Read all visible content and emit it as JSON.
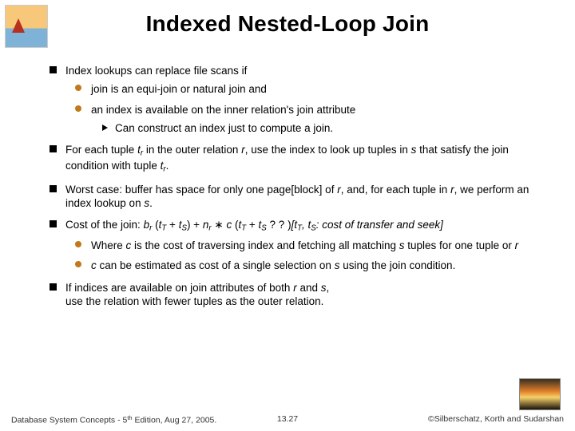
{
  "title": "Indexed Nested-Loop Join",
  "b1": {
    "text": "Index lookups can replace file scans if",
    "s1": "join is an equi-join or natural join and",
    "s2": "an index is available on the inner relation's join attribute",
    "s2a": "Can construct an index just to compute a join."
  },
  "b2": {
    "p1": "For each tuple",
    "p2": "in the outer relation",
    "p3": ", use the index to look up tuples in",
    "p4": "that satisfy the join condition with tuple"
  },
  "b3": {
    "p1": "Worst case: buffer has space for only one page[block] of",
    "p2": ", and, for each tuple in",
    "p3": ", we perform an index lookup on"
  },
  "b4": {
    "p1": "Cost of the join:",
    "p2": "? ? )",
    "p3": "cost of transfer and seek",
    "s1a": "Where",
    "s1b": "is the cost of traversing index and fetching all matching",
    "s1c": "tuples for one tuple or",
    "s2a": "can be estimated as cost of a single selection on",
    "s2b": "using the join condition."
  },
  "b5": {
    "p1": "If indices are available on join attributes of both",
    "p2": "and",
    "p3": "use the relation with fewer tuples as the outer relation."
  },
  "footer": {
    "leftA": "Database System Concepts - 5",
    "leftSup": "th",
    "leftB": "Edition, Aug 27, 2005.",
    "center": "13.27",
    "right": "©Silberschatz, Korth and Sudarshan"
  }
}
